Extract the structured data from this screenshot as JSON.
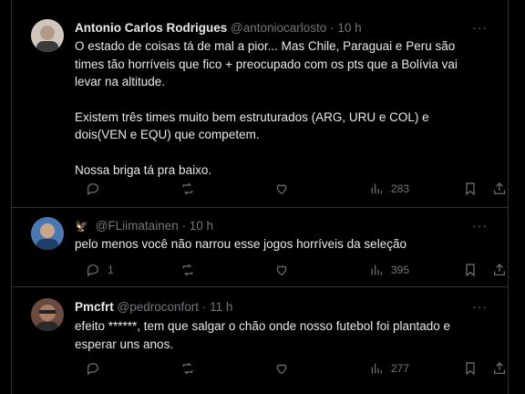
{
  "tweets": [
    {
      "name": "Antonio Carlos Rodrigues",
      "handle": "@antoniocarlosto",
      "sep": "·",
      "time": "10 h",
      "paragraphs": [
        "O estado de coisas tá de mal a pior... Mas Chile, Paraguai e Peru são times tão horríveis que fico + preocupado com os pts que a Bolívia vai levar na altitude.",
        "Existem três times muito bem estruturados (ARG, URU e COL) e dois(VEN e EQU) que competem.",
        "Nossa briga tá pra baixo."
      ],
      "replies": "",
      "views": "283",
      "avatar_color": "#8b7d72"
    },
    {
      "name": "",
      "emoji": "🦅",
      "handle": "@FLiimatainen",
      "sep": "·",
      "time": "10 h",
      "paragraphs": [
        "pelo menos você não narrou esse jogos horríveis da seleção"
      ],
      "replies": "1",
      "views": "395",
      "avatar_color": "#3a6ea5"
    },
    {
      "name": "Pmcfrt",
      "handle": "@pedroconfort",
      "sep": "·",
      "time": "11 h",
      "paragraphs": [
        "efeito ******, tem que salgar o chão onde nosso futebol foi plantado e esperar uns anos."
      ],
      "replies": "",
      "views": "277",
      "avatar_color": "#5a4038"
    }
  ],
  "more_label": "···",
  "icons": [
    "reply-icon",
    "retweet-icon",
    "like-icon",
    "views-icon",
    "bookmark-icon",
    "share-icon"
  ],
  "colors": {
    "background": "#000000",
    "text": "#e7e9ea",
    "muted": "#71767b",
    "border": "#2f3336"
  }
}
